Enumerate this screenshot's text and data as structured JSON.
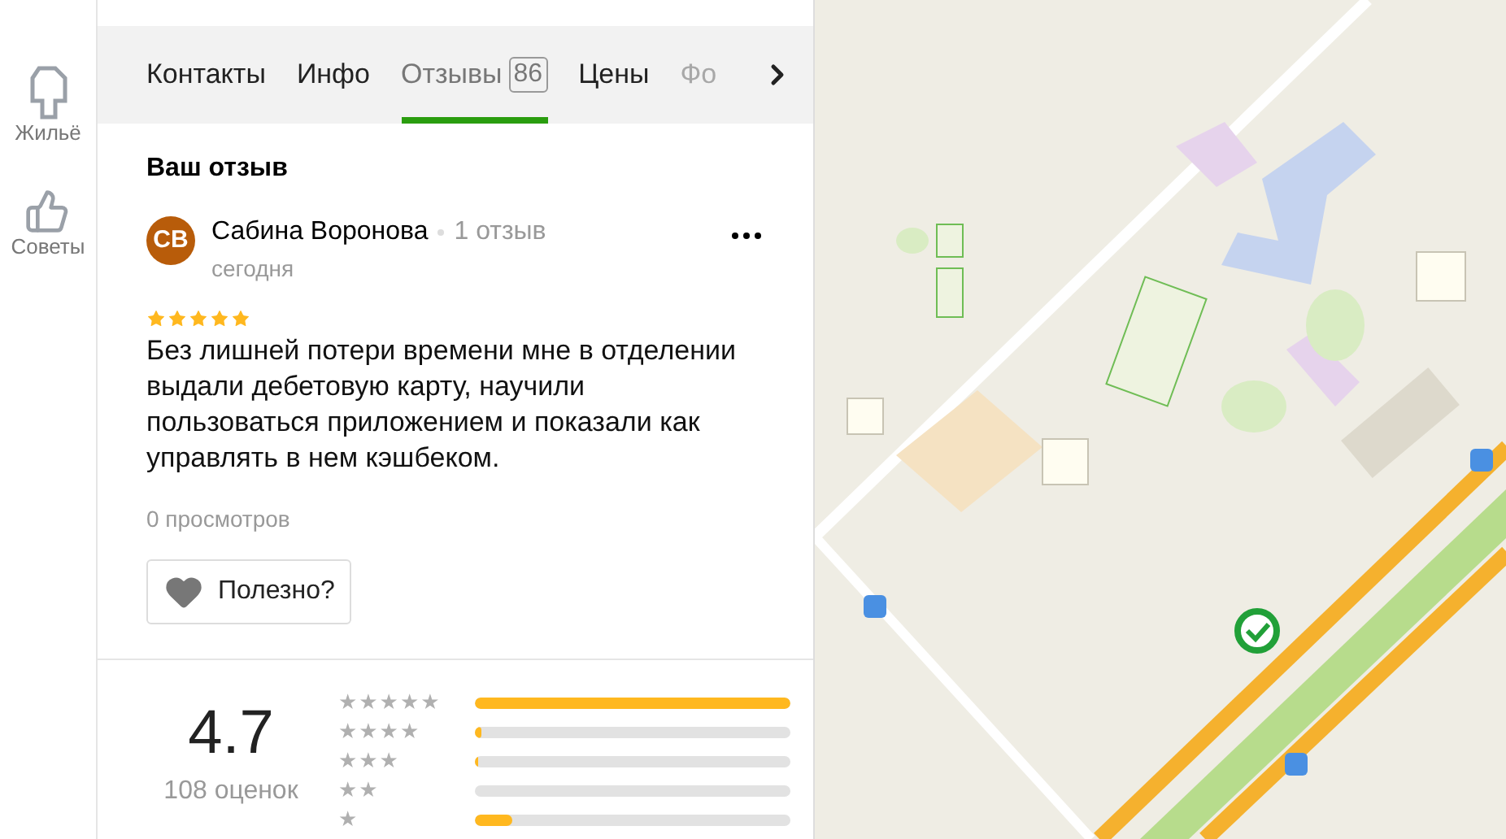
{
  "sidebar": {
    "items": [
      {
        "label": "Жильё"
      },
      {
        "label": "Советы"
      }
    ]
  },
  "tabs": [
    {
      "label": "Контакты",
      "selected": false
    },
    {
      "label": "Инфо",
      "selected": false
    },
    {
      "label": "Отзывы",
      "badge": "86",
      "selected": true
    },
    {
      "label": "Цены",
      "selected": false
    },
    {
      "label": "Фо",
      "selected": false,
      "faded": true
    }
  ],
  "my_review": {
    "heading": "Ваш отзыв",
    "initials": "СВ",
    "author": "Сабина Воронова",
    "author_reviews": "1 отзыв",
    "date": "сегодня",
    "stars": 5,
    "text": "Без лишней потери времени мне в отделении выдали дебетовую карту, научили пользоваться приложением и показали как управлять в нем кэшбеком.",
    "views": "0 просмотров",
    "helpful_button": "Полезно?"
  },
  "rating": {
    "score": "4.7",
    "count": "108 оценок",
    "bars": [
      {
        "label": "★★★★★",
        "level": 1.0
      },
      {
        "label": "★★★★",
        "level": 0.02
      },
      {
        "label": "★★★",
        "level": 0.01
      },
      {
        "label": "★★"
      },
      {
        "label": "★",
        "level": 0.12
      }
    ]
  }
}
